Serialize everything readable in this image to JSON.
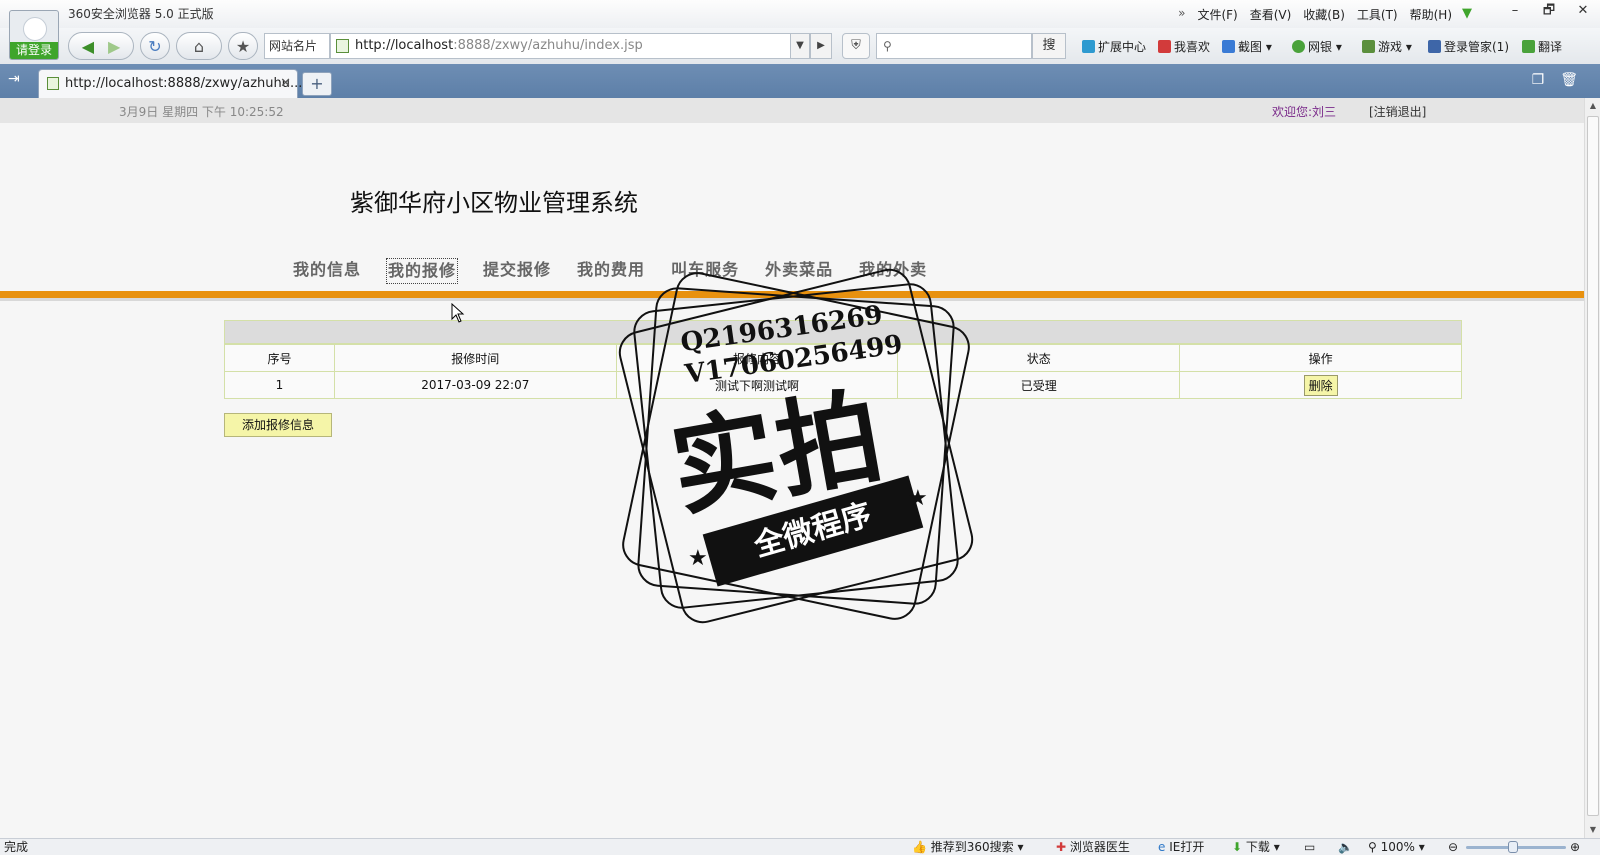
{
  "browser": {
    "app_title": "360安全浏览器 5.0 正式版",
    "login_label": "请登录",
    "menu": [
      "文件(F)",
      "查看(V)",
      "收藏(B)",
      "工具(T)",
      "帮助(H)"
    ],
    "menu_chevron": "»",
    "window_buttons": [
      "–",
      "🗗",
      "✕"
    ],
    "site_card_label": "网站名片",
    "url_host": "http://localhost",
    "url_rest": ":8888/zxwy/azhuhu/index.jsp",
    "search_placeholder": "",
    "search_button": "搜",
    "extensions": [
      "扩展中心",
      "我喜欢",
      "截图",
      "网银",
      "游戏",
      "登录管家(1)",
      "翻译"
    ],
    "tab_title": "http://localhost:8888/zxwy/azhuhu...",
    "new_tab": "+",
    "status_left": "完成",
    "status_items": [
      "推荐到360搜索",
      "浏览器医生",
      "IE打开",
      "下载",
      "100%"
    ]
  },
  "page": {
    "datetime": "3月9日  星期四  下午  10:25:52",
    "welcome_prefix": "欢迎您:",
    "user_name": "刘三",
    "logout": "[注销退出]",
    "site_title": "紫御华府小区物业管理系统",
    "nav": [
      "我的信息",
      "我的报修",
      "提交报修",
      "我的费用",
      "叫车服务",
      "外卖菜品",
      "我的外卖"
    ],
    "active_nav_index": 1,
    "table": {
      "headers": [
        "序号",
        "报修时间",
        "报修内容",
        "状态",
        "操作"
      ],
      "rows": [
        {
          "index": "1",
          "time": "2017-03-09 22:07",
          "content": "测试下啊测试啊",
          "status": "已受理",
          "action": "删除"
        }
      ]
    },
    "add_button": "添加报修信息"
  },
  "watermark": {
    "qq": "Q2196316269",
    "vx": "V17060256499",
    "big_text": "实拍",
    "ribbon_text": "全微程序"
  },
  "colors": {
    "accent_orange": "#e8910f",
    "button_yellow": "#f5f5a8",
    "table_border": "#d4e0a8",
    "tabbar_blue": "#6e8eb4"
  }
}
